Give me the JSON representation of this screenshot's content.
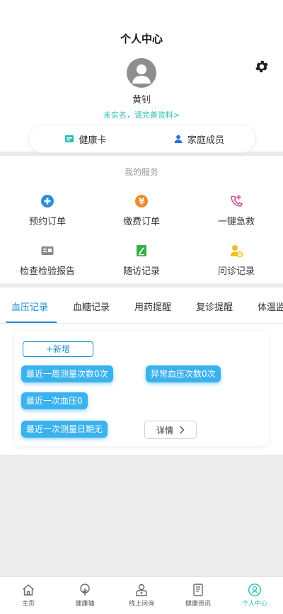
{
  "header": {
    "title": "个人中心"
  },
  "profile": {
    "name": "黄钊",
    "verify_prompt": "未实名，请完善资料>"
  },
  "card_bar": {
    "health_card": "健康卡",
    "family": "家庭成员"
  },
  "services": {
    "title": "我的服务",
    "items": [
      {
        "label": "预约订单",
        "icon": "plus-circle-icon",
        "color": "#2a8fd6"
      },
      {
        "label": "缴费订单",
        "icon": "yen-coin-icon",
        "color": "#f08b2b"
      },
      {
        "label": "一键急救",
        "icon": "phone-plus-icon",
        "color": "#d0509a"
      },
      {
        "label": "检查检验报告",
        "icon": "report-card-icon",
        "color": "#8a8a8a"
      },
      {
        "label": "随访记录",
        "icon": "edit-note-icon",
        "color": "#3aae4a"
      },
      {
        "label": "问诊记录",
        "icon": "user-clock-icon",
        "color": "#f0c020"
      }
    ]
  },
  "record_tabs": [
    "血压记录",
    "血糖记录",
    "用药提醒",
    "复诊提醒",
    "体温监"
  ],
  "bp": {
    "add_label": "+新增",
    "week_count": "最近一周测量次数0次",
    "abnormal_count": "异常血压次数0次",
    "last_bp": "最近一次血压0",
    "last_date": "最近一次测量日期无",
    "detail_label": "详情"
  },
  "bottom_nav": [
    {
      "label": "主页",
      "icon": "home-icon"
    },
    {
      "label": "健康轴",
      "icon": "tree-icon"
    },
    {
      "label": "线上问询",
      "icon": "doctor-icon"
    },
    {
      "label": "健康资讯",
      "icon": "phone-document-icon"
    },
    {
      "label": "个人中心",
      "icon": "person-circle-icon"
    }
  ],
  "colors": {
    "accent": "#2bbfb1",
    "tab_active": "#1d8fd1",
    "pill": "#3ab2ee"
  }
}
